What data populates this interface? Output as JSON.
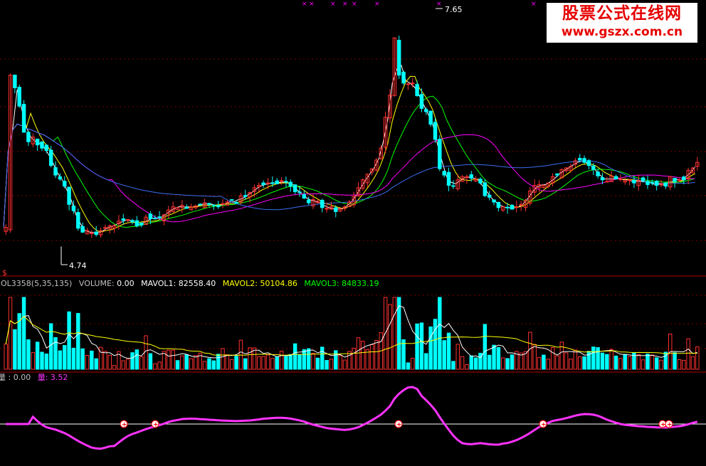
{
  "chart_data": [
    {
      "type": "candlestick",
      "label_high": "7.65",
      "label_low": "4.74",
      "ma_colors": [
        "#ffffff",
        "#ffff00",
        "#00ff00",
        "#ff00ff",
        "#3b6df0"
      ],
      "close": [
        4.98,
        6.9,
        6.74,
        6.51,
        6.18,
        6.06,
        6.12,
        6.02,
        5.98,
        5.95,
        5.76,
        5.64,
        5.59,
        5.5,
        5.27,
        5.19,
        4.97,
        4.92,
        4.94,
        4.91,
        4.89,
        4.94,
        4.98,
        5.0,
        5.0,
        5.06,
        5.07,
        5.08,
        5.05,
        5.0,
        5.01,
        5.11,
        5.09,
        5.09,
        5.1,
        5.14,
        5.2,
        5.24,
        5.23,
        5.26,
        5.22,
        5.24,
        5.25,
        5.27,
        5.29,
        5.27,
        5.26,
        5.24,
        5.28,
        5.3,
        5.32,
        5.29,
        5.38,
        5.37,
        5.42,
        5.48,
        5.51,
        5.52,
        5.54,
        5.54,
        5.53,
        5.57,
        5.55,
        5.5,
        5.43,
        5.42,
        5.35,
        5.29,
        5.33,
        5.31,
        5.23,
        5.22,
        5.24,
        5.18,
        5.22,
        5.24,
        5.3,
        5.37,
        5.48,
        5.58,
        5.65,
        5.72,
        5.83,
        5.98,
        6.37,
        6.65,
        7.37,
        6.9,
        6.8,
        6.79,
        6.8,
        6.64,
        6.48,
        6.44,
        6.28,
        6.09,
        5.72,
        5.64,
        5.51,
        5.5,
        5.58,
        5.62,
        5.62,
        5.6,
        5.59,
        5.54,
        5.38,
        5.36,
        5.3,
        5.23,
        5.24,
        5.23,
        5.21,
        5.24,
        5.27,
        5.32,
        5.44,
        5.51,
        5.52,
        5.51,
        5.54,
        5.62,
        5.64,
        5.71,
        5.73,
        5.75,
        5.82,
        5.83,
        5.8,
        5.76,
        5.71,
        5.63,
        5.58,
        5.56,
        5.63,
        5.59,
        5.59,
        5.57,
        5.58,
        5.54,
        5.57,
        5.57,
        5.52,
        5.54,
        5.51,
        5.53,
        5.5,
        5.62,
        5.56,
        5.58,
        5.58,
        5.7,
        5.73,
        5.8
      ],
      "candles_visible": 146
    },
    {
      "type": "bar",
      "header": "OL3358(5,35,135)",
      "series": [
        {
          "name": "VOLUME",
          "value": "0.00"
        },
        {
          "name": "MAVOL1",
          "value": "82558.40"
        },
        {
          "name": "MAVOL2",
          "value": "50104.86"
        },
        {
          "name": "MAVOL3",
          "value": "84833.19"
        }
      ]
    },
    {
      "type": "line",
      "series": [
        {
          "name": "量",
          "value": "0.00"
        },
        {
          "name": "量",
          "value": "3.52"
        }
      ],
      "signal_positions": [
        174,
        218,
        560,
        763,
        931,
        940
      ]
    }
  ],
  "text": {
    "vol_header": "OL3358(5,35,135)",
    "vol_label": "VOLUME",
    "vol_value": "0.00",
    "mavol1_label": "MAVOL1",
    "mavol1_value": "82558.40",
    "mavol2_label": "MAVOL2",
    "mavol2_value": "50104.86",
    "mavol3_label": "MAVOL3",
    "mavol3_value": "84833.19",
    "ind_label1": "量",
    "ind_value1": "0.00",
    "ind_label2": "量",
    "ind_value2": "3.52",
    "dollar_icon": "$"
  },
  "colors": {
    "up": "#ff3030",
    "down": "#00ffff",
    "grid": "#7a0000",
    "indicator": "#ff33ff",
    "mark": "#ff00ff"
  },
  "watermark": {
    "title": "股票公式在线网",
    "url": "www.gszx.com.cn"
  }
}
